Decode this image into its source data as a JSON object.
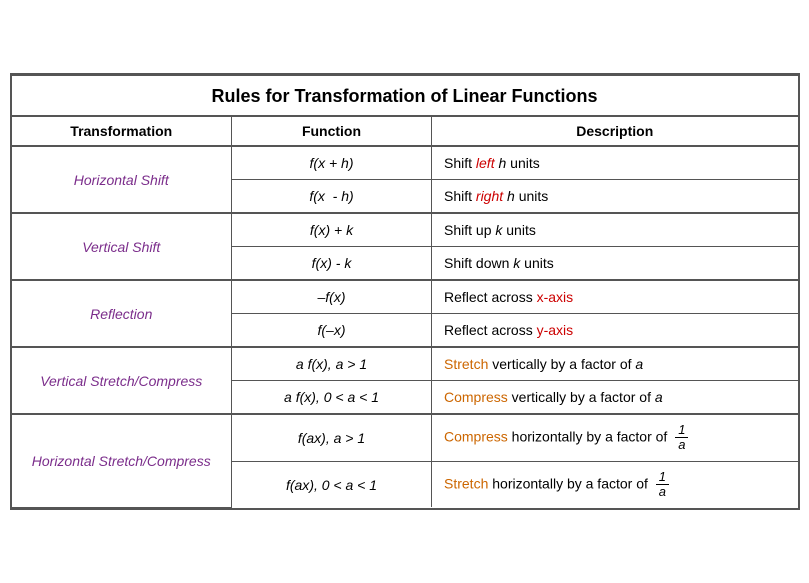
{
  "table": {
    "title": "Rules for Transformation of Linear Functions",
    "headers": [
      "Transformation",
      "Function",
      "Description"
    ],
    "rows": [
      {
        "transform": "Horizontal Shift",
        "transform_color": "purple",
        "rowspan": 2,
        "sub_rows": [
          {
            "function": "f(x + h)",
            "desc_parts": [
              {
                "text": "Shift ",
                "color": "black"
              },
              {
                "text": "left",
                "color": "red"
              },
              {
                "text": " h units",
                "color": "black"
              }
            ]
          },
          {
            "function": "f(x  - h)",
            "desc_parts": [
              {
                "text": "Shift ",
                "color": "black"
              },
              {
                "text": "right",
                "color": "red"
              },
              {
                "text": " h units",
                "color": "black"
              }
            ]
          }
        ]
      },
      {
        "transform": "Vertical Shift",
        "transform_color": "purple",
        "rowspan": 2,
        "sub_rows": [
          {
            "function": "f(x) + k",
            "desc_parts": [
              {
                "text": "Shift ",
                "color": "black"
              },
              {
                "text": "up",
                "color": "black"
              },
              {
                "text": " k units",
                "color": "black"
              }
            ]
          },
          {
            "function": "f(x) - k",
            "desc_parts": [
              {
                "text": "Shift ",
                "color": "black"
              },
              {
                "text": "down",
                "color": "black"
              },
              {
                "text": " k units",
                "color": "black"
              }
            ]
          }
        ]
      },
      {
        "transform": "Reflection",
        "transform_color": "purple",
        "rowspan": 2,
        "sub_rows": [
          {
            "function": "–f(x)",
            "desc_parts": [
              {
                "text": "Reflect across ",
                "color": "black"
              },
              {
                "text": "x-axis",
                "color": "red"
              }
            ]
          },
          {
            "function": "f(–x)",
            "desc_parts": [
              {
                "text": "Reflect across ",
                "color": "black"
              },
              {
                "text": "y-axis",
                "color": "red"
              }
            ]
          }
        ]
      },
      {
        "transform": "Vertical Stretch/Compress",
        "transform_color": "purple",
        "rowspan": 2,
        "sub_rows": [
          {
            "function": "a f(x), a > 1",
            "desc_parts": [
              {
                "text": "Stretch",
                "color": "orange"
              },
              {
                "text": " vertically by a factor of a",
                "color": "black"
              }
            ]
          },
          {
            "function": "a f(x), 0 < a < 1",
            "desc_parts": [
              {
                "text": "Compress",
                "color": "orange"
              },
              {
                "text": " vertically by a factor of a",
                "color": "black"
              }
            ]
          }
        ]
      },
      {
        "transform": "Horizontal Stretch/Compress",
        "transform_color": "purple",
        "rowspan": 2,
        "sub_rows": [
          {
            "function": "f(ax), a > 1",
            "desc_type": "fraction",
            "desc_parts": [
              {
                "text": "Compress",
                "color": "orange"
              },
              {
                "text": " horizontally by a factor of ",
                "color": "black"
              }
            ],
            "fraction": {
              "num": "1",
              "den": "a"
            }
          },
          {
            "function": "f(ax), 0 < a < 1",
            "desc_type": "fraction",
            "desc_parts": [
              {
                "text": "Stretch",
                "color": "orange"
              },
              {
                "text": " horizontally by a factor of ",
                "color": "black"
              }
            ],
            "fraction": {
              "num": "1",
              "den": "a"
            }
          }
        ]
      }
    ]
  }
}
